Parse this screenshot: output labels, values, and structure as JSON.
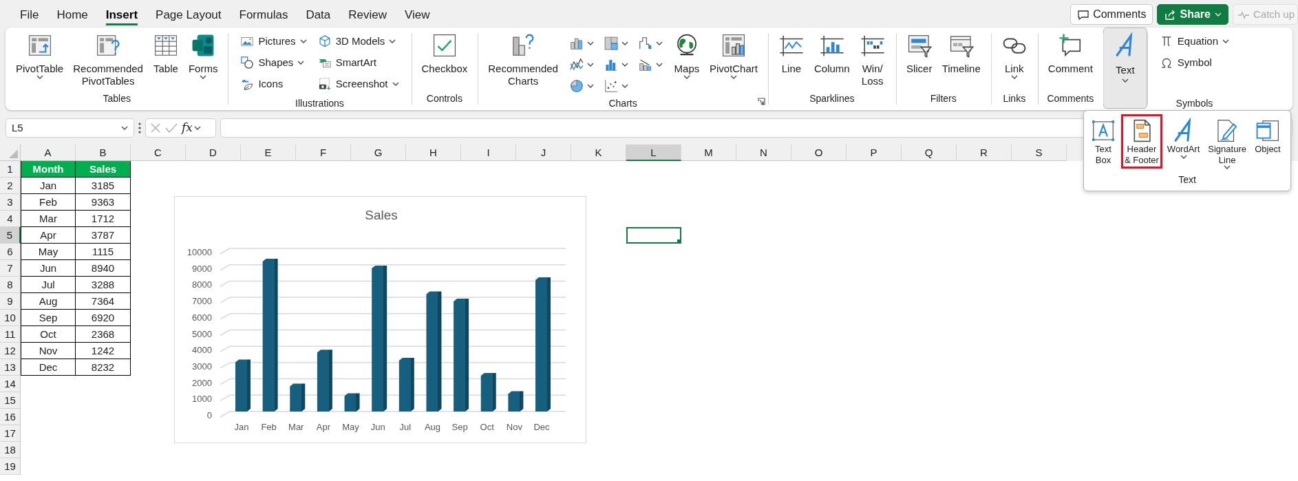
{
  "tabs": [
    {
      "label": "File",
      "selected": false
    },
    {
      "label": "Home",
      "selected": false
    },
    {
      "label": "Insert",
      "selected": true
    },
    {
      "label": "Page Layout",
      "selected": false
    },
    {
      "label": "Formulas",
      "selected": false
    },
    {
      "label": "Data",
      "selected": false
    },
    {
      "label": "Review",
      "selected": false
    },
    {
      "label": "View",
      "selected": false
    }
  ],
  "top_buttons": [
    {
      "kind": "comments",
      "label": "Comments",
      "disabled": false
    },
    {
      "kind": "share",
      "label": "Share",
      "disabled": false
    },
    {
      "kind": "catch_up",
      "label": "Catch up",
      "disabled": true
    }
  ],
  "ribbon": {
    "groups": [
      {
        "label": "Tables",
        "items": [
          {
            "kind": "large",
            "label": "PivotTable",
            "dropdown": true
          },
          {
            "kind": "large",
            "label": "Recommended\nPivotTables"
          },
          {
            "kind": "large",
            "label": "Table"
          },
          {
            "kind": "large",
            "label": "Forms",
            "dropdown": true
          }
        ]
      },
      {
        "label": "Illustrations",
        "items": [
          {
            "kind": "small",
            "label": "Pictures",
            "dropdown": true
          },
          {
            "kind": "small",
            "label": "Shapes",
            "dropdown": true
          },
          {
            "kind": "small",
            "label": "Icons"
          },
          {
            "kind": "small",
            "label": "3D Models",
            "dropdown": true
          },
          {
            "kind": "small",
            "label": "SmartArt"
          },
          {
            "kind": "small",
            "label": "Screenshot",
            "dropdown": true
          }
        ]
      },
      {
        "label": "Controls",
        "items": [
          {
            "kind": "large",
            "label": "Checkbox"
          }
        ]
      },
      {
        "label": "Charts",
        "launcher": true,
        "items": [
          {
            "kind": "large",
            "label": "Recommended\nCharts"
          },
          {
            "kind": "icon",
            "dropdown": true
          },
          {
            "kind": "icon",
            "dropdown": true
          },
          {
            "kind": "icon",
            "dropdown": true
          },
          {
            "kind": "icon",
            "dropdown": true
          },
          {
            "kind": "icon",
            "dropdown": true
          },
          {
            "kind": "icon",
            "dropdown": true
          },
          {
            "kind": "icon",
            "dropdown": true
          },
          {
            "kind": "icon",
            "dropdown": true
          },
          {
            "kind": "large",
            "label": "Maps",
            "dropdown": true
          },
          {
            "kind": "large",
            "label": "PivotChart",
            "dropdown": true
          }
        ]
      },
      {
        "label": "Sparklines",
        "items": [
          {
            "kind": "large",
            "label": "Line"
          },
          {
            "kind": "large",
            "label": "Column"
          },
          {
            "kind": "large",
            "label": "Win/\nLoss"
          }
        ]
      },
      {
        "label": "Filters",
        "items": [
          {
            "kind": "large",
            "label": "Slicer"
          },
          {
            "kind": "large",
            "label": "Timeline"
          }
        ]
      },
      {
        "label": "Links",
        "items": [
          {
            "kind": "large",
            "label": "Link",
            "dropdown": true
          }
        ]
      },
      {
        "label": "Comments",
        "items": [
          {
            "kind": "large",
            "label": "Comment"
          }
        ]
      },
      {
        "items": [
          {
            "kind": "menu",
            "label": "Text",
            "dropdown": true,
            "expanded": true
          }
        ]
      },
      {
        "label": "Symbols",
        "items": [
          {
            "kind": "small",
            "label": "Equation",
            "dropdown": true
          },
          {
            "kind": "small",
            "label": "Symbol"
          }
        ]
      }
    ]
  },
  "text_menu": {
    "label": "Text",
    "items": [
      {
        "label": "Text\nBox",
        "highlighted": false
      },
      {
        "label": "Header\n& Footer",
        "highlighted": true
      },
      {
        "label": "WordArt",
        "dropdown": true,
        "highlighted": false
      },
      {
        "label": "Signature\nLine",
        "dropdown": true,
        "highlighted": false
      },
      {
        "label": "Object",
        "highlighted": false
      }
    ]
  },
  "formula_bar": {
    "name_box": "L5",
    "function_label": "fx"
  },
  "sheet": {
    "columns": [
      {
        "label": "A",
        "selected": false
      },
      {
        "label": "B",
        "selected": false
      },
      {
        "label": "C",
        "selected": false
      },
      {
        "label": "D",
        "selected": false
      },
      {
        "label": "E",
        "selected": false
      },
      {
        "label": "F",
        "selected": false
      },
      {
        "label": "G",
        "selected": false
      },
      {
        "label": "H",
        "selected": false
      },
      {
        "label": "I",
        "selected": false
      },
      {
        "label": "J",
        "selected": false
      },
      {
        "label": "K",
        "selected": false
      },
      {
        "label": "L",
        "selected": true
      },
      {
        "label": "M",
        "selected": false
      },
      {
        "label": "N",
        "selected": false
      },
      {
        "label": "O",
        "selected": false
      },
      {
        "label": "P",
        "selected": false
      },
      {
        "label": "Q",
        "selected": false
      },
      {
        "label": "R",
        "selected": false
      },
      {
        "label": "S",
        "selected": false
      }
    ],
    "rows": [
      {
        "label": "1",
        "selected": false,
        "kind": "header",
        "cells": [
          "Month",
          "Sales"
        ]
      },
      {
        "label": "2",
        "selected": false,
        "kind": "data",
        "cells": [
          "Jan",
          "3185"
        ]
      },
      {
        "label": "3",
        "selected": false,
        "kind": "data",
        "cells": [
          "Feb",
          "9363"
        ]
      },
      {
        "label": "4",
        "selected": false,
        "kind": "data",
        "cells": [
          "Mar",
          "1712"
        ]
      },
      {
        "label": "5",
        "selected": true,
        "kind": "data",
        "cells": [
          "Apr",
          "3787"
        ]
      },
      {
        "label": "6",
        "selected": false,
        "kind": "data",
        "cells": [
          "May",
          "1115"
        ]
      },
      {
        "label": "7",
        "selected": false,
        "kind": "data",
        "cells": [
          "Jun",
          "8940"
        ]
      },
      {
        "label": "8",
        "selected": false,
        "kind": "data",
        "cells": [
          "Jul",
          "3288"
        ]
      },
      {
        "label": "9",
        "selected": false,
        "kind": "data",
        "cells": [
          "Aug",
          "7364"
        ]
      },
      {
        "label": "10",
        "selected": false,
        "kind": "data",
        "cells": [
          "Sep",
          "6920"
        ]
      },
      {
        "label": "11",
        "selected": false,
        "kind": "data",
        "cells": [
          "Oct",
          "2368"
        ]
      },
      {
        "label": "12",
        "selected": false,
        "kind": "data",
        "cells": [
          "Nov",
          "1242"
        ]
      },
      {
        "label": "13",
        "selected": false,
        "kind": "data",
        "cells": [
          "Dec",
          "8232"
        ]
      },
      {
        "label": "14",
        "selected": false
      },
      {
        "label": "15",
        "selected": false
      },
      {
        "label": "16",
        "selected": false
      },
      {
        "label": "17",
        "selected": false
      },
      {
        "label": "18",
        "selected": false
      },
      {
        "label": "19",
        "selected": false
      }
    ],
    "chart": {
      "chart_data": {
        "type": "bar",
        "title": "Sales",
        "categories": [
          "Jan",
          "Feb",
          "Mar",
          "Apr",
          "May",
          "Jun",
          "Jul",
          "Aug",
          "Sep",
          "Oct",
          "Nov",
          "Dec"
        ],
        "values": [
          3185,
          9363,
          1712,
          3787,
          1115,
          8940,
          3288,
          7364,
          6920,
          2368,
          1242,
          8232
        ],
        "ylim": [
          0,
          10000
        ],
        "yticks": [
          0,
          1000,
          2000,
          3000,
          4000,
          5000,
          6000,
          7000,
          8000,
          9000,
          10000
        ],
        "grid": true
      }
    }
  }
}
